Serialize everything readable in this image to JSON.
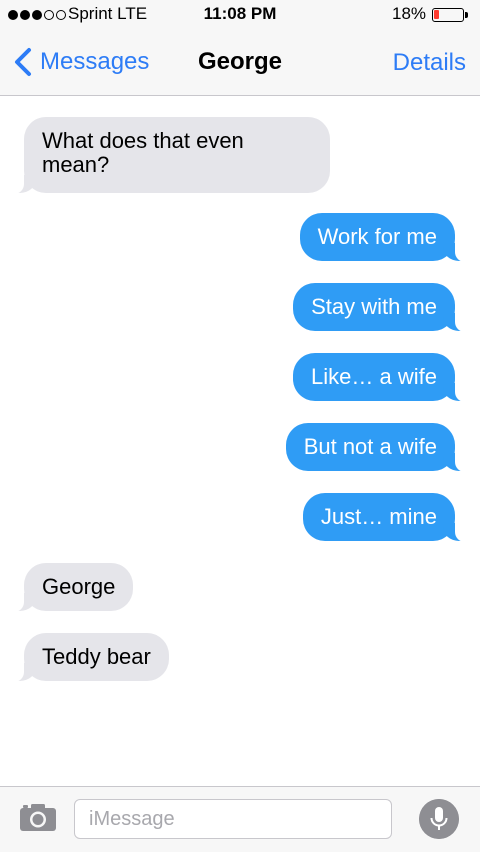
{
  "status_bar": {
    "signal_bars_full": 3,
    "signal_bars_total": 5,
    "carrier": "Sprint  LTE",
    "time": "11:08 PM",
    "battery_percent": "18%",
    "battery_level": 0.18,
    "battery_color": "#ff3b30"
  },
  "nav": {
    "back_label": "Messages",
    "back_icon": "chevron-left-icon",
    "title": "George",
    "details_label": "Details"
  },
  "messages": [
    {
      "direction": "incoming",
      "text": "What does that even mean?"
    },
    {
      "direction": "outgoing",
      "text": "Work for me"
    },
    {
      "direction": "outgoing",
      "text": "Stay with me"
    },
    {
      "direction": "outgoing",
      "text": "Like… a wife"
    },
    {
      "direction": "outgoing",
      "text": "But not a wife"
    },
    {
      "direction": "outgoing",
      "text": "Just… mine"
    },
    {
      "direction": "incoming",
      "text": "George"
    },
    {
      "direction": "incoming",
      "text": "Teddy bear"
    }
  ],
  "input_bar": {
    "camera_icon": "camera-icon",
    "placeholder": "iMessage",
    "value": "",
    "mic_icon": "microphone-icon"
  },
  "colors": {
    "accent": "#2d7cf6",
    "outgoing_bubble": "#2f9cf5",
    "incoming_bubble": "#e5e5ea"
  }
}
